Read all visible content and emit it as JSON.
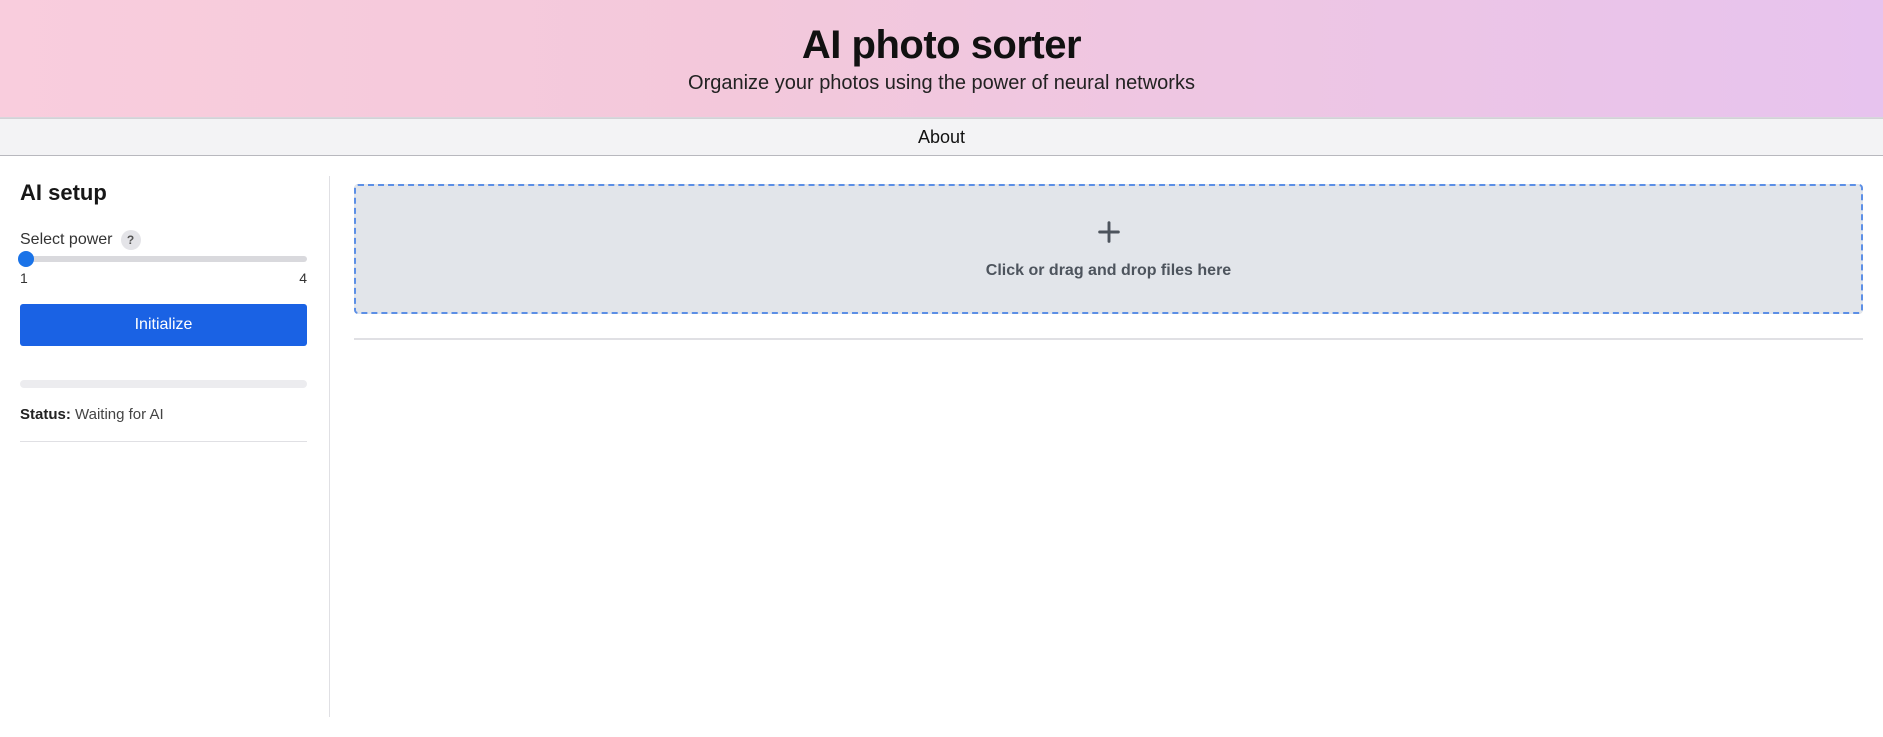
{
  "hero": {
    "title": "AI photo sorter",
    "subtitle": "Organize your photos using the power of neural networks"
  },
  "nav": {
    "about": "About"
  },
  "sidebar": {
    "heading": "AI setup",
    "power_label": "Select power",
    "help_glyph": "?",
    "slider": {
      "min": "1",
      "max": "4",
      "value": 1
    },
    "initialize_label": "Initialize",
    "status_label": "Status:",
    "status_value": "Waiting for AI"
  },
  "dropzone": {
    "text": "Click or drag and drop files here"
  }
}
